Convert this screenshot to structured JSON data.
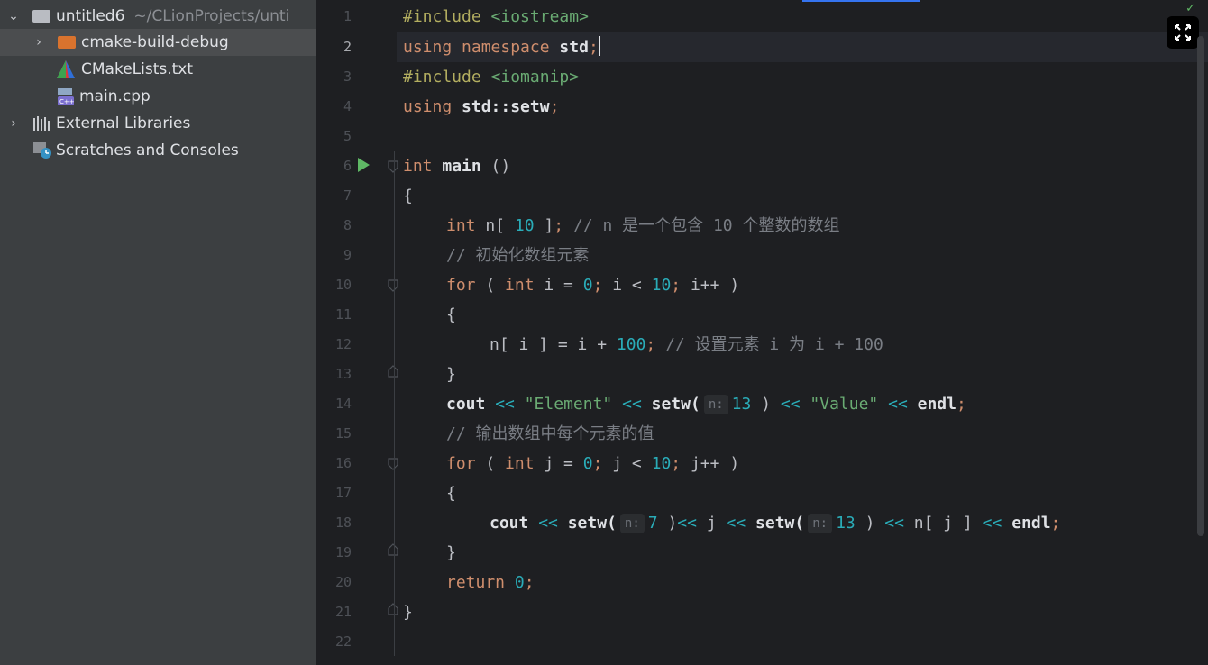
{
  "project_tree": {
    "root": {
      "name": "untitled6",
      "path": "~/CLionProjects/unti"
    },
    "items": [
      {
        "label": "cmake-build-debug"
      },
      {
        "label": "CMakeLists.txt"
      },
      {
        "label": "main.cpp"
      },
      {
        "label": "External Libraries"
      },
      {
        "label": "Scratches and Consoles"
      }
    ]
  },
  "editor": {
    "line_numbers": [
      "1",
      "2",
      "3",
      "4",
      "5",
      "6",
      "7",
      "8",
      "9",
      "10",
      "11",
      "12",
      "13",
      "14",
      "15",
      "16",
      "17",
      "18",
      "19",
      "20",
      "21",
      "22"
    ],
    "active_line": "2",
    "code": {
      "l1": {
        "directive": "#include",
        "header": "<iostream>"
      },
      "l2": {
        "k1": "using",
        "k2": "namespace",
        "id": "std",
        "semi": ";"
      },
      "l3": {
        "directive": "#include",
        "header": "<iomanip>"
      },
      "l4": {
        "k1": "using",
        "id": "std::setw",
        "semi": ";"
      },
      "l6": {
        "fold": "",
        "type": "int",
        "name": "main",
        "parens": " ()"
      },
      "l7": {
        "brace": "{"
      },
      "l8": {
        "type": "int",
        "rest1": " n[ ",
        "num": "10",
        "rest2": " ]",
        "semi": ";",
        "comment": " // n 是一个包含 10 个整数的数组"
      },
      "l9": {
        "comment": "// 初始化数组元素"
      },
      "l10": {
        "kw": "for",
        "p1": " ( ",
        "type": "int",
        "v1": " i = ",
        "n1": "0",
        "s1": ";",
        "v2": " i < ",
        "n2": "10",
        "s2": ";",
        "v3": " i++ )"
      },
      "l11": {
        "brace": "{"
      },
      "l12": {
        "v1": "n[ i ] = i + ",
        "num": "100",
        "semi": ";",
        "comment": " // 设置元素 i 为 i + 100"
      },
      "l13": {
        "brace": "}"
      },
      "l14": {
        "cout": "cout",
        "op1": " << ",
        "str1": "\"Element\"",
        "op2": " << ",
        "fn": "setw(",
        "hint": "n:",
        "num": "13",
        "close": " )",
        "op3": " << ",
        "str2": "\"Value\"",
        "op4": " << ",
        "endl": "endl",
        "semi": ";"
      },
      "l15": {
        "comment": "// 输出数组中每个元素的值"
      },
      "l16": {
        "kw": "for",
        "p1": " ( ",
        "type": "int",
        "v1": " j = ",
        "n1": "0",
        "s1": ";",
        "v2": " j < ",
        "n2": "10",
        "s2": ";",
        "v3": " j++ )"
      },
      "l17": {
        "brace": "{"
      },
      "l18": {
        "cout": "cout",
        "op1": " << ",
        "fn1": "setw(",
        "hint1": "n:",
        "num1": "7",
        "close1": " )",
        "op2": "<< ",
        "j": "j",
        "op3": " << ",
        "fn2": "setw(",
        "hint2": "n:",
        "num2": "13",
        "close2": " )",
        "op4": " << ",
        "arr": "n[ j ]",
        "op5": " << ",
        "endl": "endl",
        "semi": ";"
      },
      "l19": {
        "brace": "}"
      },
      "l20": {
        "kw": "return",
        "num": "0",
        "semi": ";"
      },
      "l21": {
        "brace": "}"
      }
    }
  }
}
